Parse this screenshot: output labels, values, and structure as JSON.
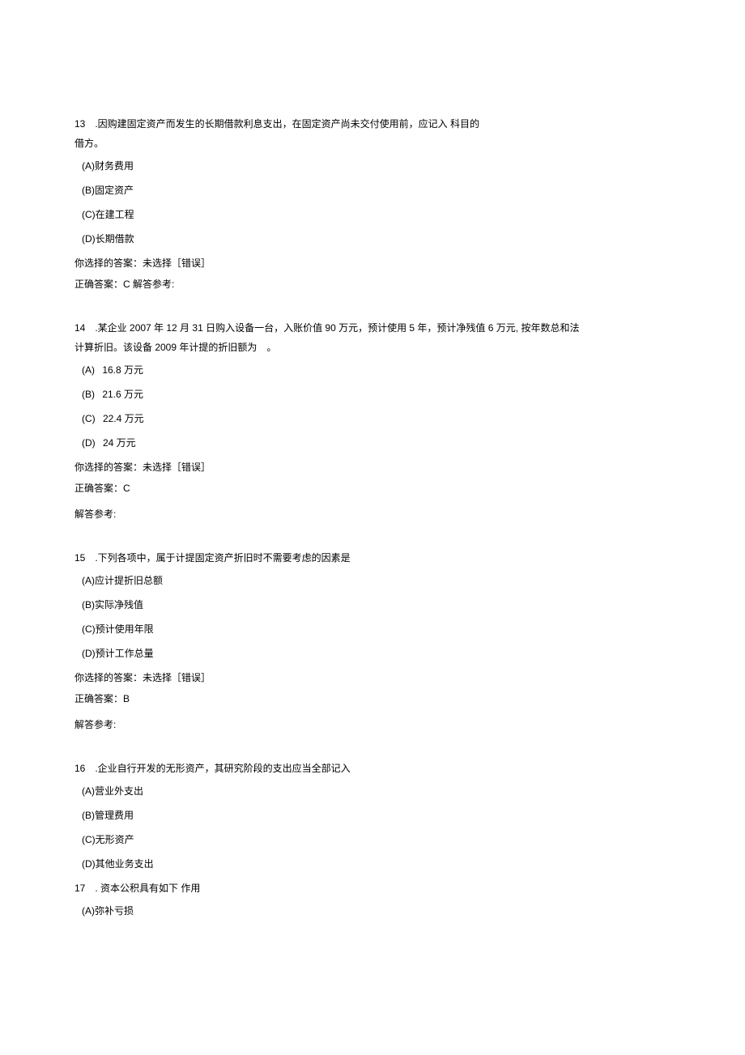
{
  "q13": {
    "line1": "13 .因购建固定资产而发生的长期借款利息支出，在固定资产尚未交付使用前，应记入 科目的",
    "line2": "借方。",
    "opts": {
      "a": "(A)财务费用",
      "b": "(B)固定资产",
      "c": "(C)在建工程",
      "d": "(D)长期借款"
    },
    "sel": "你选择的答案：未选择［错误］",
    "correct": "正确答案：C 解答参考:"
  },
  "q14": {
    "line1": "14 .某企业 2007 年 12 月 31 日购入设备一台，入账价值 90 万元，预计使用 5 年，预计净残值 6 万元, 按年数总和法",
    "line2": "计算折旧。该设备 2009 年计提的折旧额为 。",
    "opts": {
      "a": "(A)  16.8 万元",
      "b": "(B)  21.6 万元",
      "c": "(C)  22.4 万元",
      "d": "(D)  24 万元"
    },
    "sel": "你选择的答案：未选择［错误］",
    "correct": "正确答案：C",
    "explain": "解答参考:"
  },
  "q15": {
    "line1": "15 .下列各项中，属于计提固定资产折旧时不需要考虑的因素是",
    "opts": {
      "a": "(A)应计提折旧总额",
      "b": "(B)实际净残值",
      "c": "(C)预计使用年限",
      "d": "(D)预计工作总量"
    },
    "sel": "你选择的答案：未选择［错误］",
    "correct": "正确答案：B",
    "explain": "解答参考:"
  },
  "q16": {
    "line1": "16 .企业自行开发的无形资产，其研究阶段的支出应当全部记入",
    "opts": {
      "a": "(A)营业外支出",
      "b": "(B)管理费用",
      "c": "(C)无形资产",
      "d": "(D)其他业务支出"
    }
  },
  "q17": {
    "line1": "17 . 资本公积具有如下 作用",
    "opts": {
      "a": "(A)弥补亏损"
    }
  }
}
